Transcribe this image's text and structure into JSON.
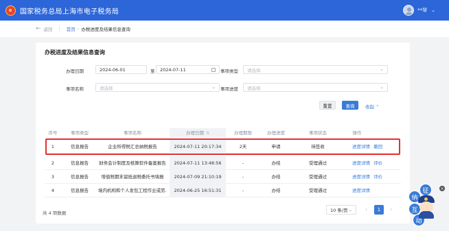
{
  "header": {
    "brand": "国家税务总局上海市电子税务局",
    "user_name": "**琴",
    "caret": "⌄"
  },
  "breadcrumb": {
    "back": "返回",
    "home": "首页",
    "separator": "›",
    "current": "办税进度及结果信息查询"
  },
  "panel": {
    "title": "办税进度及结果信息查询"
  },
  "filters": {
    "date_label": "办理日期",
    "date_start": "2024-06-01",
    "date_to": "至",
    "date_end": "2024-07-11",
    "type_label": "事项类型",
    "type_placeholder": "请选择",
    "name_label": "事项名称",
    "name_placeholder": "请选择",
    "progress_label": "事项进度",
    "progress_placeholder": "请选择",
    "reset": "重置",
    "query": "查询",
    "collapse": "收起 ⌃"
  },
  "table": {
    "headers": [
      "序号",
      "事项类型",
      "事项名称",
      "办理日期",
      "办理期限",
      "办理进度",
      "事项状态",
      "操作"
    ],
    "rows": [
      {
        "no": "1",
        "type": "信息报告",
        "name": "企业所得税汇总纳税报告",
        "date": "2024-07-11 20:17:34",
        "limit": "2天",
        "progress": "申请",
        "status": "待签收",
        "op1": "进度详情",
        "op2": "撤回"
      },
      {
        "no": "2",
        "type": "信息报告",
        "name": "财务会计制度及核算软件备案报告",
        "date": "2024-07-11 13:48:56",
        "limit": "-",
        "progress": "办结",
        "status": "受理通过",
        "op1": "进度详情",
        "op2": "评价"
      },
      {
        "no": "3",
        "type": "信息报告",
        "name": "增值税期末留抵退税委托书填报",
        "date": "2024-07-09 21:10:19",
        "limit": "-",
        "progress": "办结",
        "status": "受理通过",
        "op1": "进度详情",
        "op2": "评价"
      },
      {
        "no": "4",
        "type": "信息报告",
        "name": "境内机构和个人发包工程作业或劳...",
        "date": "2024-06-25 16:51:31",
        "limit": "-",
        "progress": "办结",
        "status": "受理通过",
        "op1": "进度详情",
        "op2": ""
      }
    ]
  },
  "pagination": {
    "total": "共 4 项数据",
    "page_size": "10 条/页",
    "prev": "‹",
    "page": "1",
    "next": "›"
  },
  "mascot": {
    "c1": "纳",
    "c2": "征",
    "c3": "互",
    "c4": "动",
    "close": "×"
  },
  "colors": {
    "primary": "#2c66d8",
    "link": "#3a7bd5",
    "highlight": "#e23131"
  }
}
